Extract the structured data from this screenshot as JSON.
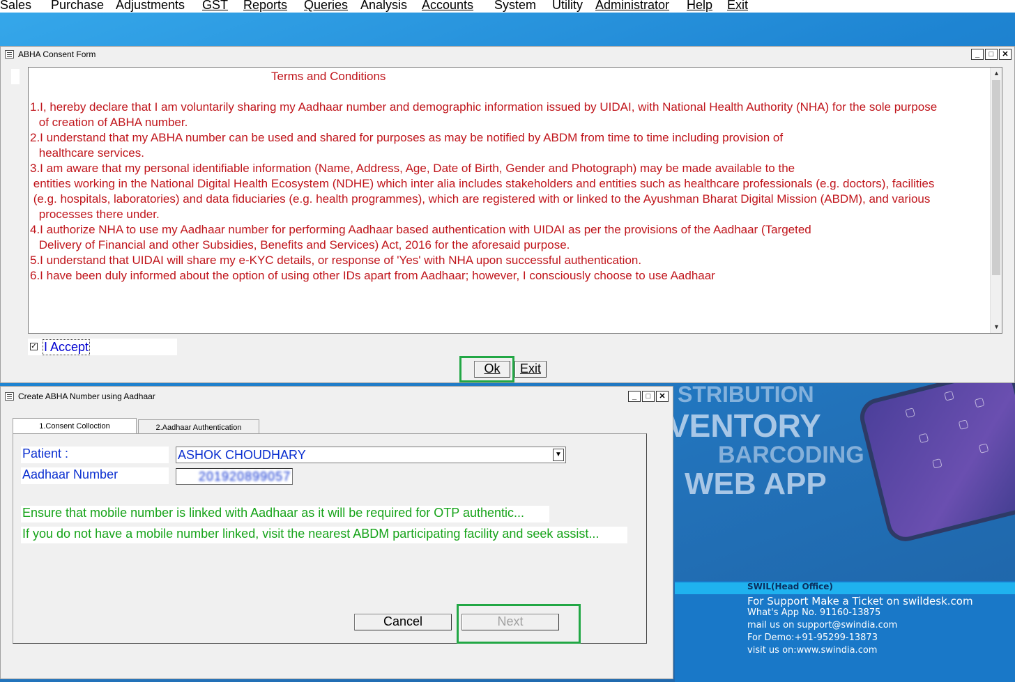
{
  "menu": {
    "items": [
      "Sales",
      "Purchase",
      "Adjustments",
      "GST",
      "Reports",
      "Queries",
      "Analysis",
      "Accounts",
      "System",
      "Utility",
      "Administrator",
      "Help",
      "Exit"
    ]
  },
  "background": {
    "line1": "STRIBUTION",
    "line2": "VENTORY",
    "line3": "BARCODING",
    "line4": "WEB APP"
  },
  "consent_window": {
    "title": "ABHA Consent Form",
    "controls": {
      "minimize": "_",
      "maximize": "□",
      "close": "✕"
    },
    "terms_title": "Terms and Conditions",
    "terms": [
      "1.I, hereby declare that I am voluntarily sharing my Aadhaar number and demographic information issued by UIDAI, with National Health Authority (NHA) for the sole purpose",
      " of creation of ABHA number.",
      "2.I understand that my ABHA number can be used and shared for purposes as may be notified by ABDM from time to time including provision of",
      " healthcare services.",
      "3.I am aware that my personal identifiable information (Name, Address, Age, Date of Birth, Gender and Photograph) may be made available to the",
      " entities working in the National Digital Health Ecosystem (NDHE) which inter alia includes stakeholders and entities such as healthcare professionals (e.g. doctors), facilities",
      " (e.g. hospitals, laboratories) and data fiduciaries (e.g. health programmes), which are registered with or linked to the Ayushman Bharat Digital Mission (ABDM), and various",
      " processes there under.",
      "4.I authorize NHA to use my Aadhaar number for performing Aadhaar based authentication with UIDAI as per the provisions of the Aadhaar (Targeted",
      " Delivery of Financial and other Subsidies, Benefits and Services) Act, 2016 for the aforesaid purpose.",
      "5.I understand that UIDAI will share my e-KYC details, or response of 'Yes' with NHA upon successful authentication.",
      "6.I have been duly informed about the option of using other IDs apart from Aadhaar; however, I consciously choose to use Aadhaar"
    ],
    "accept_label": "I Accept",
    "accept_checked": true,
    "ok_label": "Ok",
    "exit_label": "Exit"
  },
  "abha_window": {
    "title": "Create ABHA Number using Aadhaar",
    "tabs": [
      "1.Consent Colloction",
      "2.Aadhaar Authentication"
    ],
    "patient_label": "Patient :",
    "patient_value": "ASHOK CHOUDHARY",
    "aadhaar_label": "Aadhaar Number",
    "aadhaar_value": "201920899057",
    "note1": "Ensure that mobile number is linked with Aadhaar as it will be required for OTP authentic...",
    "note2": "If you do not have a mobile number linked, visit the nearest ABDM participating facility and seek assist...",
    "cancel_label": "Cancel",
    "next_label": "Next"
  },
  "info_panel": {
    "office": "SWIL(Head Office)",
    "support": "For Support Make a Ticket on swildesk.com",
    "whatsapp": "What's App No. 91160-13875",
    "mail": "mail us on support@swindia.com",
    "demo": "For Demo:+91-95299-13873",
    "visit": "visit us on:www.swindia.com"
  },
  "colors": {
    "terms_text": "#c0151b",
    "label_blue": "#0a2fd0",
    "note_green": "#16a319",
    "highlight": "#22a745"
  }
}
